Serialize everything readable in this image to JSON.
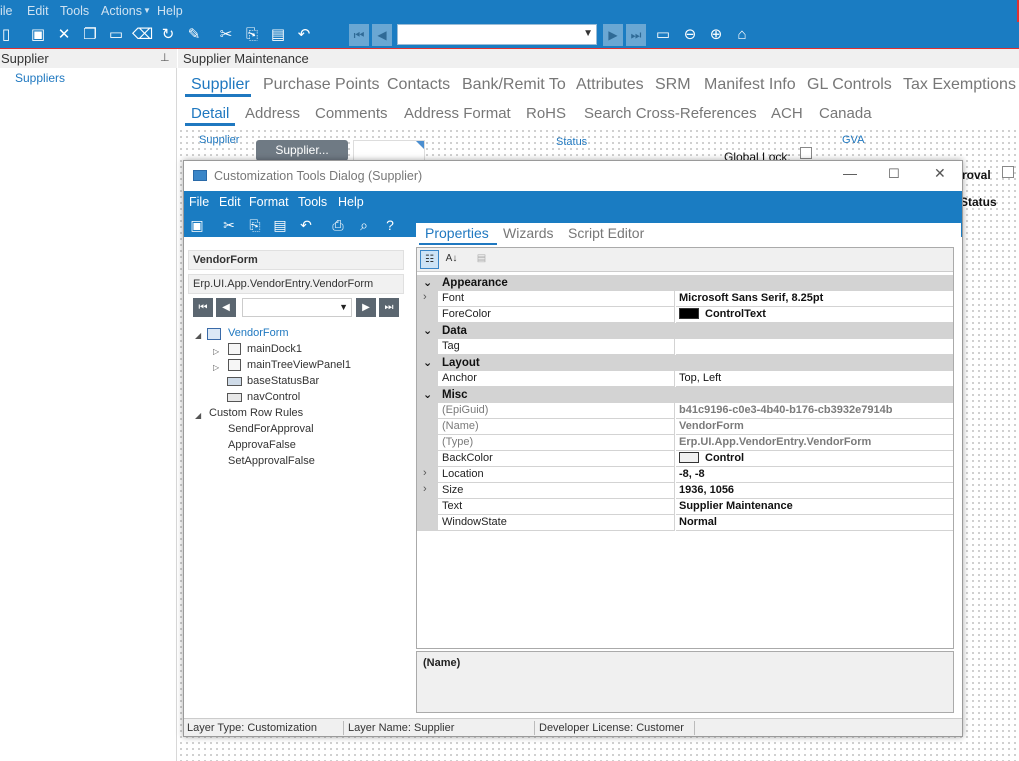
{
  "menu": {
    "file": "ile",
    "edit": "Edit",
    "tools": "Tools",
    "actions": "Actions",
    "help": "Help"
  },
  "toolbar": {
    "icons": [
      "new-icon",
      "save-icon",
      "delete-icon",
      "open-icon",
      "note-icon",
      "clear-icon",
      "refresh-icon",
      "brush-icon",
      "cut-icon",
      "copy-icon",
      "paste-icon",
      "undo-icon"
    ]
  },
  "left_pane": {
    "title": "Supplier",
    "item": "Suppliers"
  },
  "main": {
    "title": "Supplier Maintenance",
    "tabs1": [
      "Supplier",
      "Purchase Points",
      "Contacts",
      "Bank/Remit To",
      "Attributes",
      "SRM",
      "Manifest Info",
      "GL Controls",
      "Tax Exemptions"
    ],
    "tabs2": [
      "Detail",
      "Address",
      "Comments",
      "Address Format",
      "RoHS",
      "Search Cross-References",
      "ACH",
      "Canada"
    ],
    "supplier_label": "Supplier",
    "supplier_button": "Supplier...",
    "status_label": "Status",
    "gva_label": "GVA",
    "global_lock": "Global Lock:",
    "approval_fragment": "roval",
    "status_fragment": "Status"
  },
  "dialog": {
    "title": "Customization Tools Dialog  (Supplier)",
    "menu": [
      "File",
      "Edit",
      "Format",
      "Tools",
      "Help"
    ],
    "form_name": "VendorForm",
    "form_type": "Erp.UI.App.VendorEntry.VendorForm",
    "tree": {
      "root": "VendorForm",
      "children": [
        "mainDock1",
        "mainTreeViewPanel1",
        "baseStatusBar",
        "navControl"
      ],
      "rules_header": "Custom Row Rules",
      "rules": [
        "SendForApproval",
        "ApprovaFalse",
        "SetApprovalFalse"
      ]
    },
    "tabs": [
      "Properties",
      "Wizards",
      "Script Editor"
    ],
    "properties": {
      "appearance": "Appearance",
      "font_name": "Font",
      "font_value": "Microsoft Sans Serif, 8.25pt",
      "forecolor_name": "ForeColor",
      "forecolor_value": "ControlText",
      "forecolor_swatch": "#000000",
      "data": "Data",
      "tag_name": "Tag",
      "tag_value": "",
      "layout": "Layout",
      "anchor_name": "Anchor",
      "anchor_value": "Top, Left",
      "misc": "Misc",
      "epiguid_name": "(EpiGuid)",
      "epiguid_value": "b41c9196-c0e3-4b40-b176-cb3932e7914b",
      "name_name": "(Name)",
      "name_value": "VendorForm",
      "type_name": "(Type)",
      "type_value": "Erp.UI.App.VendorEntry.VendorForm",
      "backcolor_name": "BackColor",
      "backcolor_value": "Control",
      "backcolor_swatch": "#f0f0f0",
      "location_name": "Location",
      "location_value": "-8, -8",
      "size_name": "Size",
      "size_value": "1936, 1056",
      "text_name": "Text",
      "text_value": "Supplier Maintenance",
      "windowstate_name": "WindowState",
      "windowstate_value": "Normal"
    },
    "help_title": "(Name)",
    "status": {
      "layer_type": "Layer Type:  Customization",
      "layer_name": "Layer Name:  Supplier",
      "license": "Developer License:  Customer"
    }
  },
  "colors": {
    "accent": "#1a7cc2",
    "link": "#1f78c0"
  }
}
